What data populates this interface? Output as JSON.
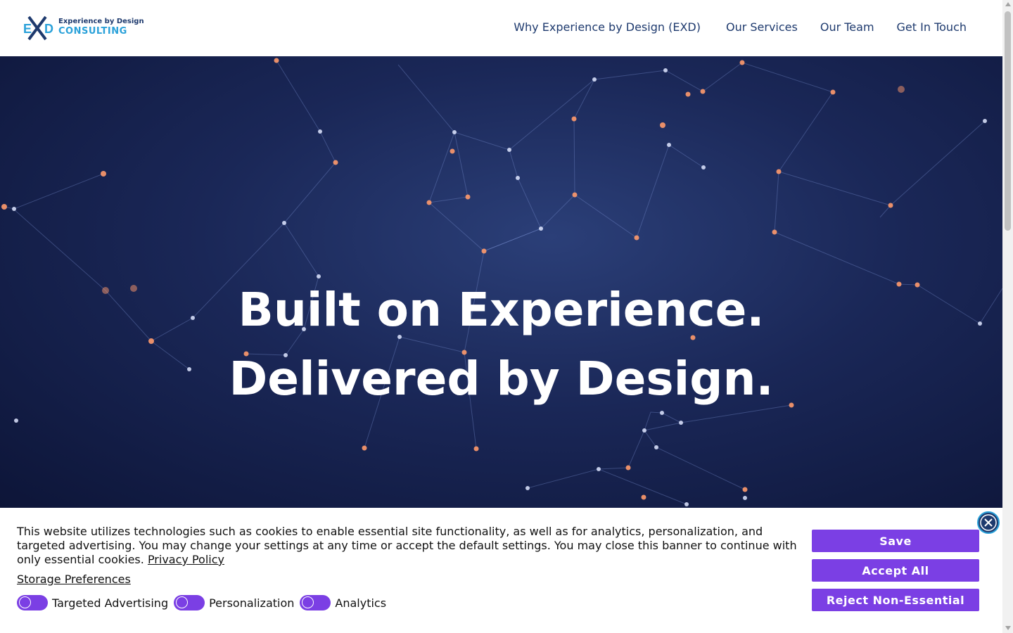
{
  "header": {
    "logo_line1": "Experience by Design",
    "logo_line2": "CONSULTING",
    "logo_mark": "EXD",
    "nav": [
      "Why Experience by Design (EXD)",
      "Our Services",
      "Our Team",
      "Get In Touch"
    ]
  },
  "hero": {
    "line1": "Built on Experience.",
    "line2": "Delivered by Design."
  },
  "cookie": {
    "text": "This website utilizes technologies such as cookies to enable essential site functionality, as well as for analytics, personalization, and targeted advertising. You may change your settings at any time or accept the default settings. You may close this banner to continue with only essential cookies.",
    "privacy_link": "Privacy Policy",
    "storage_link": "Storage Preferences",
    "toggles": [
      "Targeted Advertising",
      "Personalization",
      "Analytics"
    ],
    "buttons": {
      "save": "Save",
      "accept": "Accept All",
      "reject": "Reject Non-Essential"
    },
    "close_icon": "close-icon"
  },
  "colors": {
    "accent": "#7b3fe4",
    "navy": "#1e3a6e",
    "brand_blue": "#2aa1d9"
  }
}
